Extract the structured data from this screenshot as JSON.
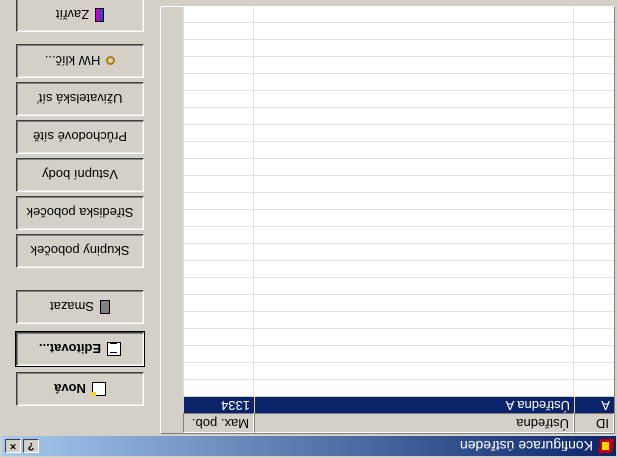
{
  "window": {
    "title": "Konfigurace ústředen",
    "help_glyph": "?",
    "close_glyph": "×"
  },
  "icons": {
    "app": "app-logo-icon",
    "new": "new-document-icon",
    "edit": "edit-document-icon",
    "delete": "trash-icon",
    "hw_key": "key-icon",
    "close": "door-exit-icon"
  },
  "table": {
    "columns": [
      "ID",
      "Ústředna",
      "Max. pob."
    ],
    "rows": [
      {
        "id": "A",
        "name": "Ústředna A",
        "max": "1334",
        "selected": true
      }
    ]
  },
  "buttons": {
    "new": "Nová",
    "edit": "Editovat...",
    "delete": "Smazat",
    "branch_groups": "Skupiny poboček",
    "branch_centers": "Střediska poboček",
    "input_points": "Vstupní body",
    "transit_networks": "Průchodové sítě",
    "user_networks": "Uživatelská síť",
    "hw_key": "HW klíč...",
    "close": "Zavřít"
  }
}
